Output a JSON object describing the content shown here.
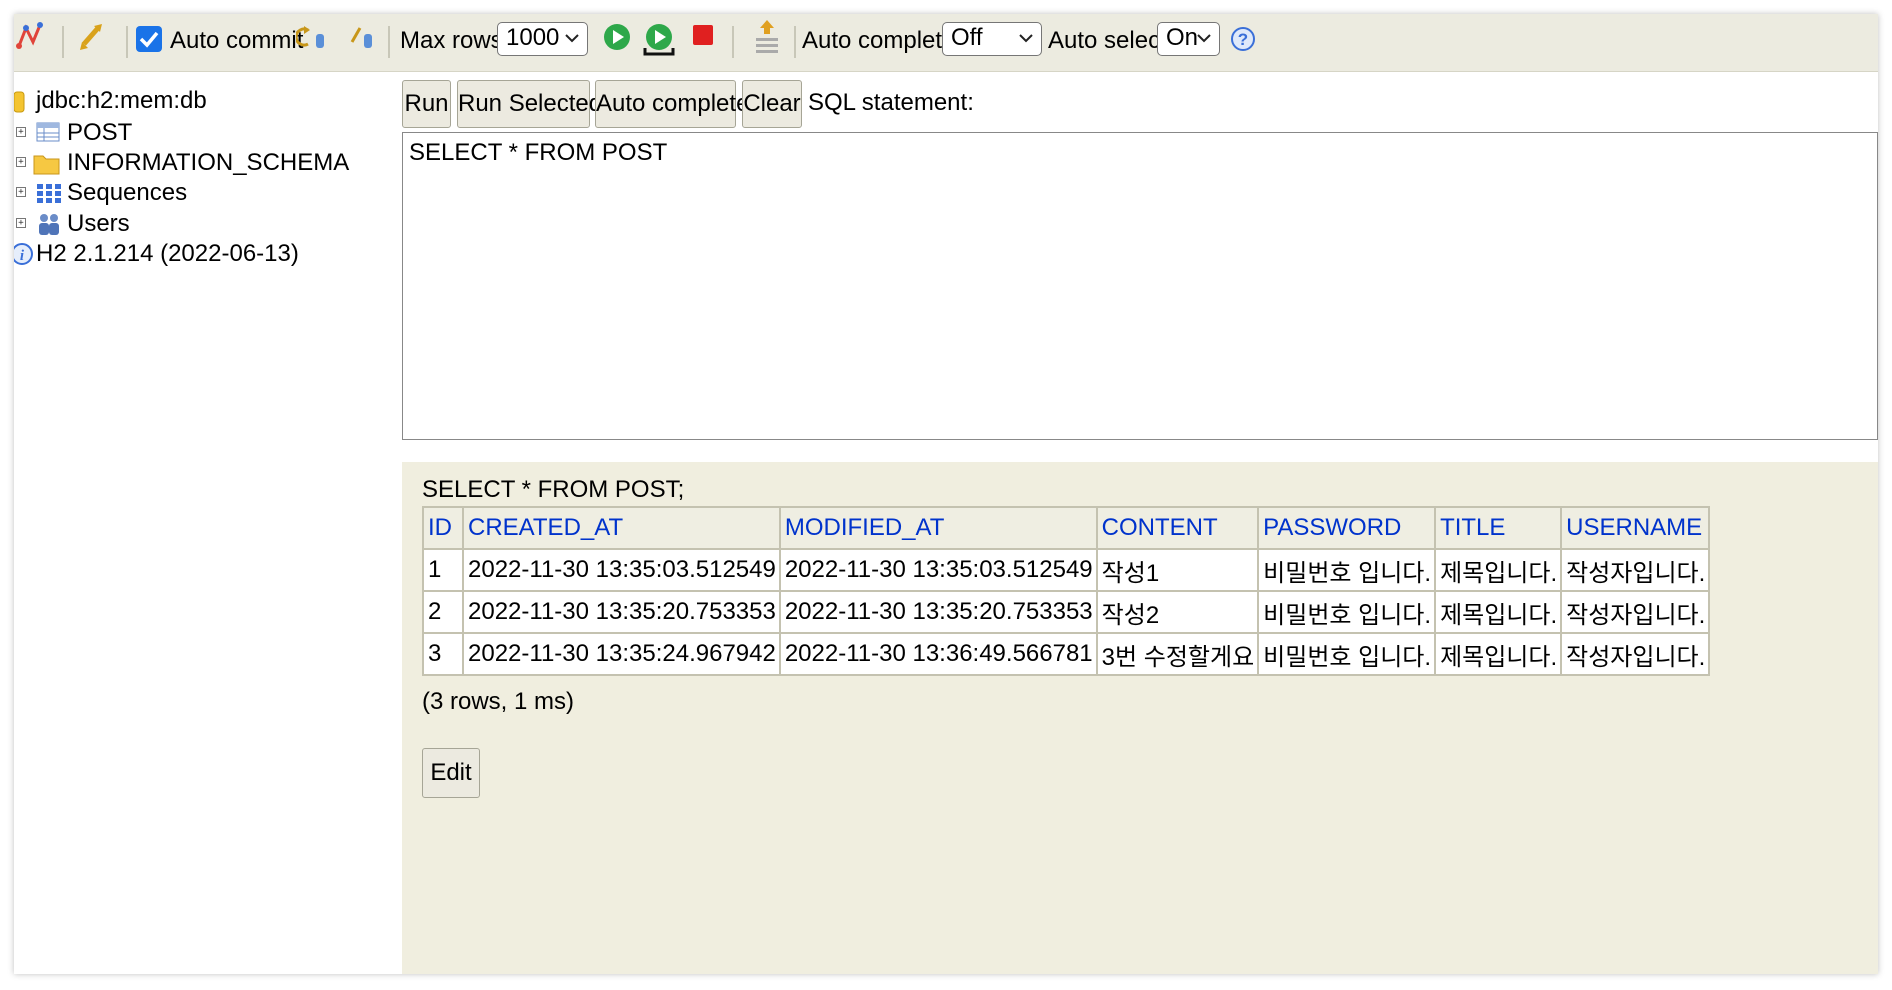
{
  "toolbar": {
    "auto_commit_label": "Auto commit",
    "max_rows_label": "Max rows:",
    "max_rows_value": "1000",
    "auto_complete_label": "Auto complete",
    "auto_complete_value": "Off",
    "auto_select_label": "Auto select",
    "auto_select_value": "On",
    "icons": [
      "disconnect-icon",
      "refresh-icon",
      "rollback-icon",
      "commit-icon",
      "run-icon",
      "run-selected-icon",
      "stop-icon",
      "history-icon",
      "help-icon"
    ]
  },
  "tree": {
    "connection": "jdbc:h2:mem:db",
    "items": [
      {
        "label": "POST",
        "icon": "table-icon"
      },
      {
        "label": "INFORMATION_SCHEMA",
        "icon": "folder-icon"
      },
      {
        "label": "Sequences",
        "icon": "sequences-icon"
      },
      {
        "label": "Users",
        "icon": "users-icon"
      }
    ],
    "version": "H2 2.1.214 (2022-06-13)"
  },
  "editor": {
    "buttons": [
      "Run",
      "Run Selected",
      "Auto complete",
      "Clear"
    ],
    "sql_label": "SQL statement:",
    "sql_text": "SELECT * FROM POST"
  },
  "result": {
    "query": "SELECT * FROM POST;",
    "columns": [
      "ID",
      "CREATED_AT",
      "MODIFIED_AT",
      "CONTENT",
      "PASSWORD",
      "TITLE",
      "USERNAME"
    ],
    "rows": [
      [
        "1",
        "2022-11-30 13:35:03.512549",
        "2022-11-30 13:35:03.512549",
        "작성1",
        "비밀번호 입니다.",
        "제목입니다.",
        "작성자입니다."
      ],
      [
        "2",
        "2022-11-30 13:35:20.753353",
        "2022-11-30 13:35:20.753353",
        "작성2",
        "비밀번호 입니다.",
        "제목입니다.",
        "작성자입니다."
      ],
      [
        "3",
        "2022-11-30 13:35:24.967942",
        "2022-11-30 13:36:49.566781",
        "3번 수정할게요",
        "비밀번호 입니다.",
        "제목입니다.",
        "작성자입니다."
      ]
    ],
    "count": "(3 rows, 1 ms)",
    "edit_label": "Edit"
  },
  "colors": {
    "toolbar_bg": "#ecebe0",
    "result_bg": "#f0eedf",
    "header_text": "#0033cc",
    "run_green": "#2ea84a",
    "stop_red": "#e02020"
  }
}
